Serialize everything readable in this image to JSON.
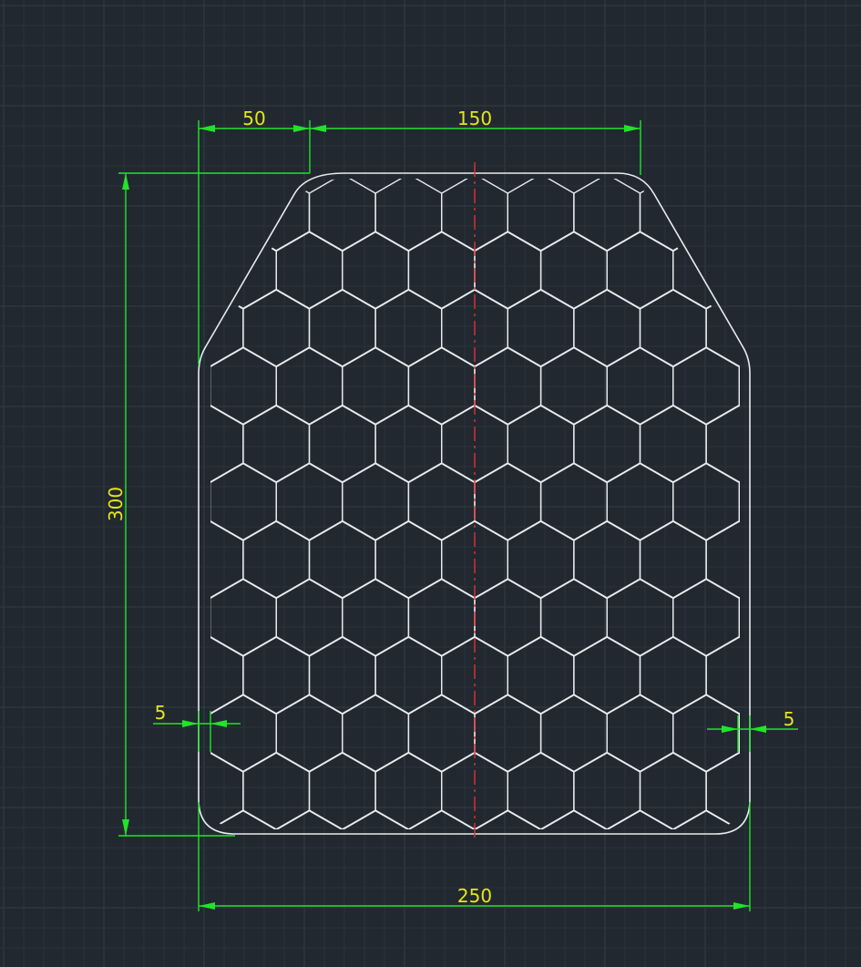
{
  "drawing": {
    "background_color": "#212830",
    "grid_minor_color": "#2a323b",
    "grid_major_color": "#323b45",
    "outline_color": "#e8ecf0",
    "dimension_line_color": "#22e32a",
    "dimension_text_color": "#e4e61a",
    "centerline_color": "#e53030"
  },
  "dimensions": {
    "top_left_width": "50",
    "top_center_width": "150",
    "height": "300",
    "bottom_width": "250",
    "left_margin": "5",
    "right_margin": "5"
  }
}
